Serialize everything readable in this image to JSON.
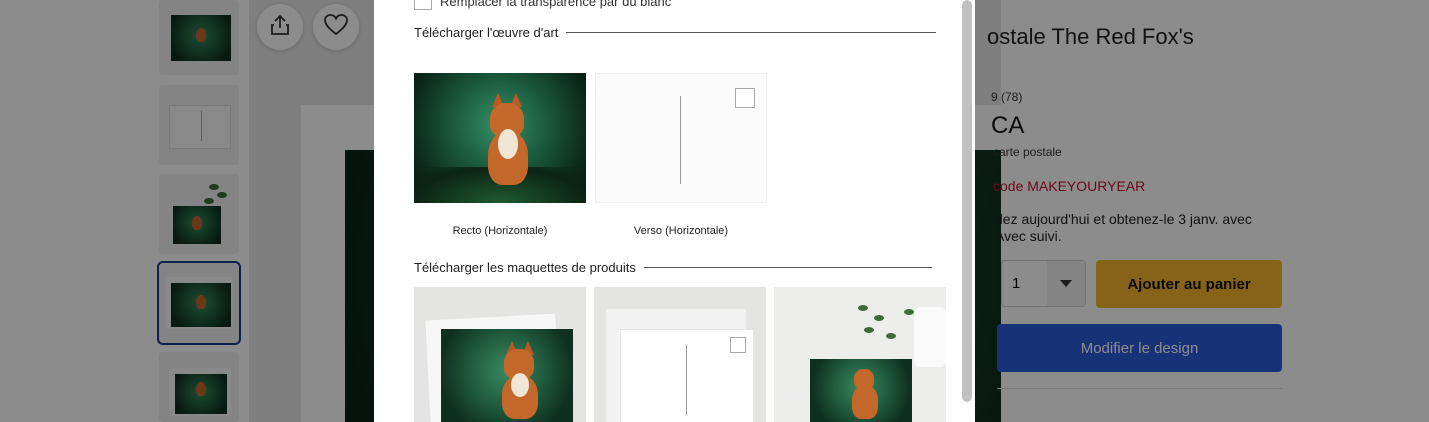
{
  "thumbnails": [
    {
      "kind": "art"
    },
    {
      "kind": "back"
    },
    {
      "kind": "mockup-plant"
    },
    {
      "kind": "art",
      "selected": true
    },
    {
      "kind": "art-small"
    }
  ],
  "product": {
    "title": "ostale The Red Fox's",
    "rating_text": "9 (78)",
    "price": "CA",
    "unit": "carte postale",
    "promo": "code MAKEYOURYEAR",
    "delivery_line1": "dez aujourd'hui et obtenez-le 3 janv. avec",
    "delivery_line2": "Avec suivi.",
    "quantity": "1",
    "add_to_cart": "Ajouter au panier",
    "edit_design": "Modifier le design"
  },
  "modal": {
    "transparency_option": "Remplacer la transparence par du blanc",
    "section_art": "Télécharger l'œuvre d'art",
    "front_caption": "Recto (Horizontale)",
    "back_caption": "Verso (Horizontale)",
    "section_mockups": "Télécharger les maquettes de produits"
  },
  "colors": {
    "promo": "#c8102e",
    "add_to_cart_bg": "#f5b52b",
    "edit_design_bg": "#2a5bd7",
    "selected_thumb_border": "#1c3b8c"
  },
  "icons": {
    "share": "share-icon",
    "favorite": "heart-icon",
    "dropdown": "chevron-down-icon"
  }
}
